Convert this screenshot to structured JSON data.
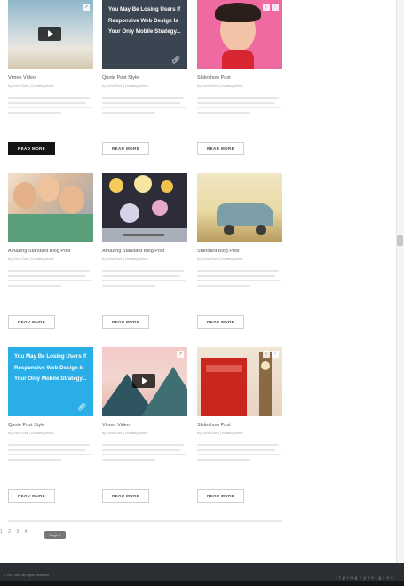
{
  "posts": [
    {
      "title": "Vimeo Video",
      "meta": "by John Doe  |  Uncategorized",
      "button": "READ MORE",
      "type": "video"
    },
    {
      "title": "Quote Post Style",
      "meta": "by John Doe  |  Uncategorized",
      "button": "READ MORE",
      "type": "quote-dark",
      "quote": "You May Be Losing Users If Responsive Web Design Is Your Only Mobile Strategy..."
    },
    {
      "title": "Slideshow Post",
      "meta": "by John Doe  |  Uncategorized",
      "button": "READ MORE",
      "type": "portrait"
    },
    {
      "title": "Amazing Standard Blog Post",
      "meta": "by John Doe  |  Uncategorized",
      "button": "READ MORE",
      "type": "friends"
    },
    {
      "title": "Amazing Standard Blog Post",
      "meta": "by John Doe  |  Uncategorized",
      "button": "READ MORE",
      "type": "bokeh"
    },
    {
      "title": "Standard Blog Post",
      "meta": "by John Doe  |  Uncategorized",
      "button": "READ MORE",
      "type": "car"
    },
    {
      "title": "Quote Post Style",
      "meta": "by John Doe  |  Uncategorized",
      "button": "READ MORE",
      "type": "quote-blue",
      "quote": "You May Be Losing Users If Responsive Web Design Is Your Only Mobile Strategy..."
    },
    {
      "title": "Vimeo Video",
      "meta": "by John Doe  |  Uncategorized",
      "button": "READ MORE",
      "type": "mountain"
    },
    {
      "title": "Slideshow Post",
      "meta": "by John Doe  |  Uncategorized",
      "button": "READ MORE",
      "type": "london"
    }
  ],
  "pagination": {
    "pages": [
      "1",
      "2",
      "3",
      "4"
    ],
    "tooltip": "Page 1"
  },
  "footer": {
    "text": "© Your Site  |  All Rights Reserved",
    "social_icons": [
      "f",
      "t",
      "p",
      "in",
      "g+",
      "yt",
      "v",
      "ig",
      "rss"
    ]
  },
  "colors": {
    "quote_dark": "#3b4552",
    "quote_blue": "#29aee8",
    "footer_bg": "#2b2e33"
  }
}
